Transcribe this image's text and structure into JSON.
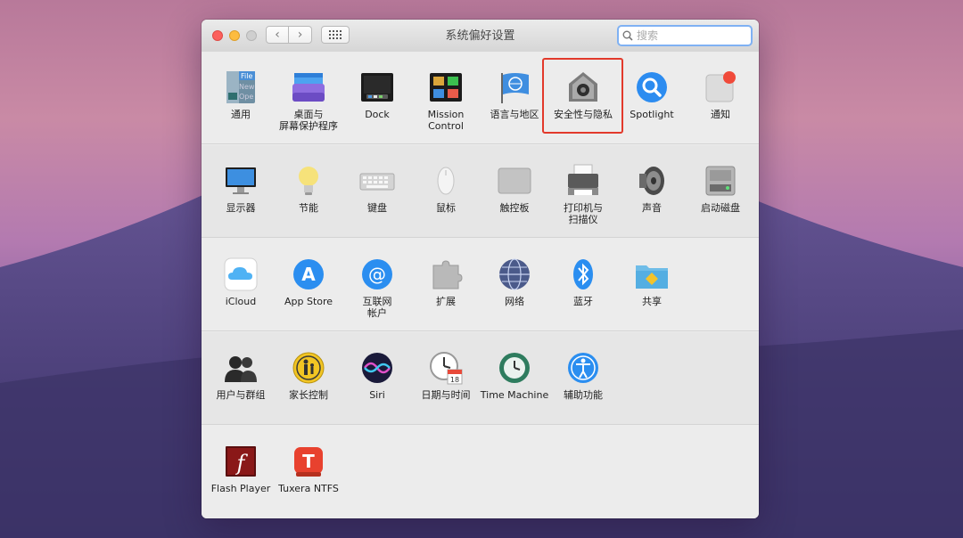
{
  "window": {
    "title": "系统偏好设置"
  },
  "toolbar": {
    "back_glyph": "‹",
    "forward_glyph": "›",
    "grid_icon": "grid-icon"
  },
  "search": {
    "placeholder": "搜索",
    "value": ""
  },
  "colors": {
    "highlight": "#e2392b",
    "search_focus": "#7fb1f3",
    "badge": "#f04a3a"
  },
  "rows": [
    {
      "items": [
        {
          "label": "通用",
          "icon": "general-icon"
        },
        {
          "label": "桌面与\n屏幕保护程序",
          "icon": "desktop-screensaver-icon"
        },
        {
          "label": "Dock",
          "icon": "dock-icon"
        },
        {
          "label": "Mission\nControl",
          "icon": "mission-control-icon"
        },
        {
          "label": "语言与地区",
          "icon": "language-region-icon"
        },
        {
          "label": "安全性与隐私",
          "icon": "security-privacy-icon"
        },
        {
          "label": "Spotlight",
          "icon": "spotlight-icon"
        },
        {
          "label": "通知",
          "icon": "notifications-icon"
        }
      ]
    },
    {
      "items": [
        {
          "label": "显示器",
          "icon": "displays-icon"
        },
        {
          "label": "节能",
          "icon": "energy-saver-icon"
        },
        {
          "label": "键盘",
          "icon": "keyboard-icon"
        },
        {
          "label": "鼠标",
          "icon": "mouse-icon"
        },
        {
          "label": "触控板",
          "icon": "trackpad-icon"
        },
        {
          "label": "打印机与\n扫描仪",
          "icon": "printers-scanners-icon"
        },
        {
          "label": "声音",
          "icon": "sound-icon"
        },
        {
          "label": "启动磁盘",
          "icon": "startup-disk-icon"
        }
      ]
    },
    {
      "items": [
        {
          "label": "iCloud",
          "icon": "icloud-icon"
        },
        {
          "label": "App Store",
          "icon": "app-store-icon"
        },
        {
          "label": "互联网\n帐户",
          "icon": "internet-accounts-icon"
        },
        {
          "label": "扩展",
          "icon": "extensions-icon"
        },
        {
          "label": "网络",
          "icon": "network-icon"
        },
        {
          "label": "蓝牙",
          "icon": "bluetooth-icon"
        },
        {
          "label": "共享",
          "icon": "sharing-icon"
        }
      ]
    },
    {
      "items": [
        {
          "label": "用户与群组",
          "icon": "users-groups-icon"
        },
        {
          "label": "家长控制",
          "icon": "parental-controls-icon"
        },
        {
          "label": "Siri",
          "icon": "siri-icon"
        },
        {
          "label": "日期与时间",
          "icon": "date-time-icon"
        },
        {
          "label": "Time Machine",
          "icon": "time-machine-icon"
        },
        {
          "label": "辅助功能",
          "icon": "accessibility-icon"
        }
      ]
    },
    {
      "items": [
        {
          "label": "Flash Player",
          "icon": "flash-player-icon"
        },
        {
          "label": "Tuxera NTFS",
          "icon": "tuxera-ntfs-icon"
        }
      ]
    }
  ],
  "icon_text": {
    "general_file": "File",
    "general_new": "New",
    "general_open": "Ope",
    "calendar_day": "18",
    "flash_letter": "f",
    "tuxera_letter": "T",
    "appstore_letter": "A",
    "internet_at": "@"
  }
}
